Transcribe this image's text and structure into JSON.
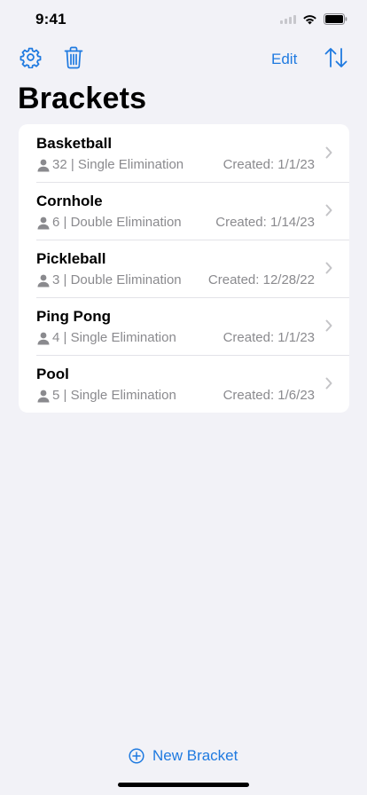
{
  "status_bar": {
    "time": "9:41"
  },
  "toolbar": {
    "settings_icon": "gear-icon",
    "trash_icon": "trash-icon",
    "edit_label": "Edit",
    "sort_icon": "sort-arrows-icon"
  },
  "page": {
    "title": "Brackets"
  },
  "brackets": [
    {
      "name": "Basketball",
      "details": "32 | Single Elimination",
      "created": "Created: 1/1/23"
    },
    {
      "name": "Cornhole",
      "details": "6 | Double Elimination",
      "created": "Created: 1/14/23"
    },
    {
      "name": "Pickleball",
      "details": "3 | Double Elimination",
      "created": "Created: 12/28/22"
    },
    {
      "name": "Ping Pong",
      "details": "4 | Single Elimination",
      "created": "Created: 1/1/23"
    },
    {
      "name": "Pool",
      "details": "5 | Single Elimination",
      "created": "Created: 1/6/23"
    }
  ],
  "footer": {
    "new_bracket_label": "New Bracket",
    "new_bracket_icon": "plus-circle-icon"
  },
  "colors": {
    "accent": "#1f7ae0",
    "background": "#f2f2f7",
    "secondary_text": "#8a8a8e"
  }
}
